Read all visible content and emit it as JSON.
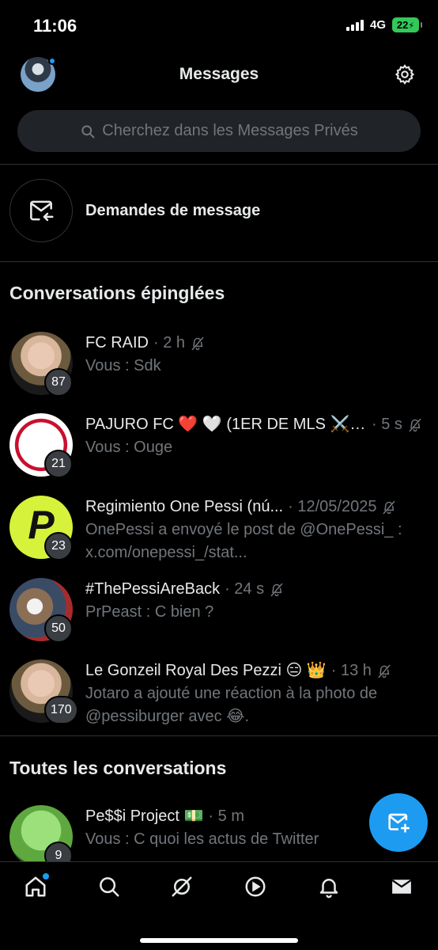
{
  "status": {
    "time": "11:06",
    "network": "4G",
    "battery": "22"
  },
  "header": {
    "title": "Messages"
  },
  "search": {
    "placeholder": "Cherchez dans les Messages Privés"
  },
  "requests": {
    "label": "Demandes de message"
  },
  "sections": {
    "pinned": "Conversations épinglées",
    "all": "Toutes les conversations"
  },
  "pinned": [
    {
      "name": "FC RAID",
      "time": "· 2 h",
      "preview": "Vous : Sdk",
      "badge": "87",
      "muted": true
    },
    {
      "name": "PAJURO FC ❤️ 🤍 (1ER DE MLS ⚔️ ...",
      "time": "· 5 s",
      "preview": "Vous : Ouge",
      "badge": "21",
      "muted": true
    },
    {
      "name": "Regimiento One Pessi (nú...",
      "time": "· 12/05/2025",
      "preview": "OnePessi a envoyé le post de @OnePessi_ : x.com/onepessi_/stat...",
      "badge": "23",
      "muted": true
    },
    {
      "name": "#ThePessiAreBack",
      "time": "· 24 s",
      "preview": "PrPeast : C bien ?",
      "badge": "50",
      "muted": true
    },
    {
      "name": "Le Gonzeil Royal Des Pezzi 😑 👑",
      "time": "· 13 h",
      "preview": "Jotaro a ajouté une réaction à la photo de @pessiburger avec 😂.",
      "badge": "170",
      "muted": true
    }
  ],
  "all": [
    {
      "name": "Pe$$i Project 💵",
      "time": "· 5 m",
      "preview": "Vous : C quoi les actus de Twitter",
      "badge": "9"
    }
  ],
  "colors": {
    "accent": "#1d9bf0",
    "background": "#000000",
    "muted_text": "#71767b",
    "battery": "#34c759"
  },
  "icons": {
    "settings": "gear-icon",
    "search": "search-icon",
    "requests": "mail-arrow-icon",
    "compose": "new-message-icon",
    "mute": "bell-off-icon"
  },
  "tabs": [
    "home-icon",
    "search-icon",
    "grok-icon",
    "video-icon",
    "notifications-icon",
    "messages-icon"
  ]
}
